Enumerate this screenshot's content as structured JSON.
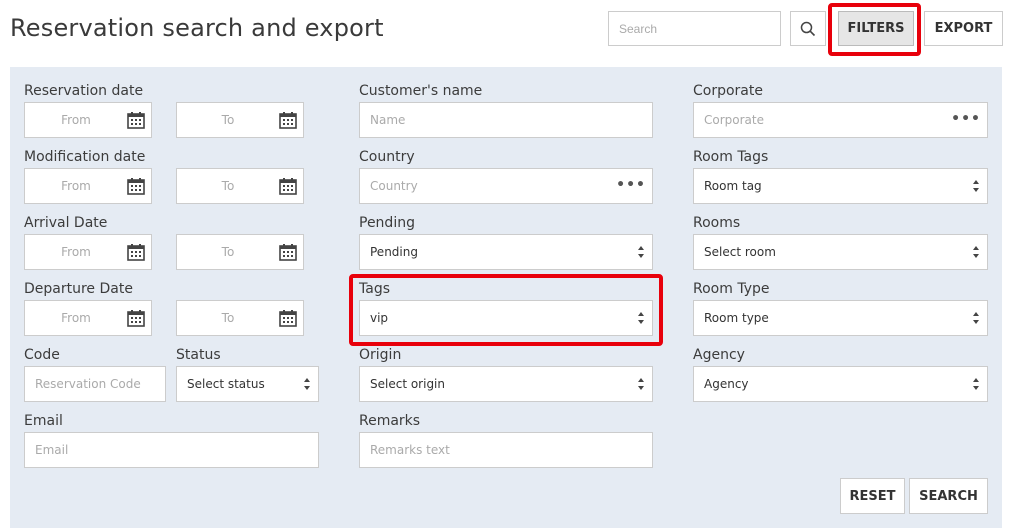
{
  "header": {
    "title": "Reservation search and export",
    "search_placeholder": "Search",
    "filters_label": "FILTERS",
    "export_label": "EXPORT"
  },
  "filters": {
    "reservation_date": {
      "label": "Reservation date",
      "from": "From",
      "to": "To"
    },
    "modification_date": {
      "label": "Modification date",
      "from": "From",
      "to": "To"
    },
    "arrival_date": {
      "label": "Arrival Date",
      "from": "From",
      "to": "To"
    },
    "departure_date": {
      "label": "Departure Date",
      "from": "From",
      "to": "To"
    },
    "code": {
      "label": "Code",
      "placeholder": "Reservation Code"
    },
    "status": {
      "label": "Status",
      "value": "Select status"
    },
    "email": {
      "label": "Email",
      "placeholder": "Email"
    },
    "customer_name": {
      "label": "Customer's name",
      "placeholder": "Name"
    },
    "country": {
      "label": "Country",
      "placeholder": "Country"
    },
    "pending": {
      "label": "Pending",
      "value": "Pending"
    },
    "tags": {
      "label": "Tags",
      "value": "vip"
    },
    "origin": {
      "label": "Origin",
      "value": "Select origin"
    },
    "remarks": {
      "label": "Remarks",
      "placeholder": "Remarks text"
    },
    "corporate": {
      "label": "Corporate",
      "placeholder": "Corporate"
    },
    "room_tags": {
      "label": "Room Tags",
      "value": "Room tag"
    },
    "rooms": {
      "label": "Rooms",
      "value": "Select room"
    },
    "room_type": {
      "label": "Room Type",
      "value": "Room type"
    },
    "agency": {
      "label": "Agency",
      "value": "Agency"
    }
  },
  "actions": {
    "reset_label": "RESET",
    "search_label": "SEARCH"
  },
  "colors": {
    "highlight": "#e8000b",
    "panel_bg": "#e5ebf3",
    "filters_active_bg": "#e6e6e6"
  },
  "icons": [
    "search-icon",
    "calendar-icon",
    "select-arrows-icon",
    "more-dots-icon"
  ]
}
